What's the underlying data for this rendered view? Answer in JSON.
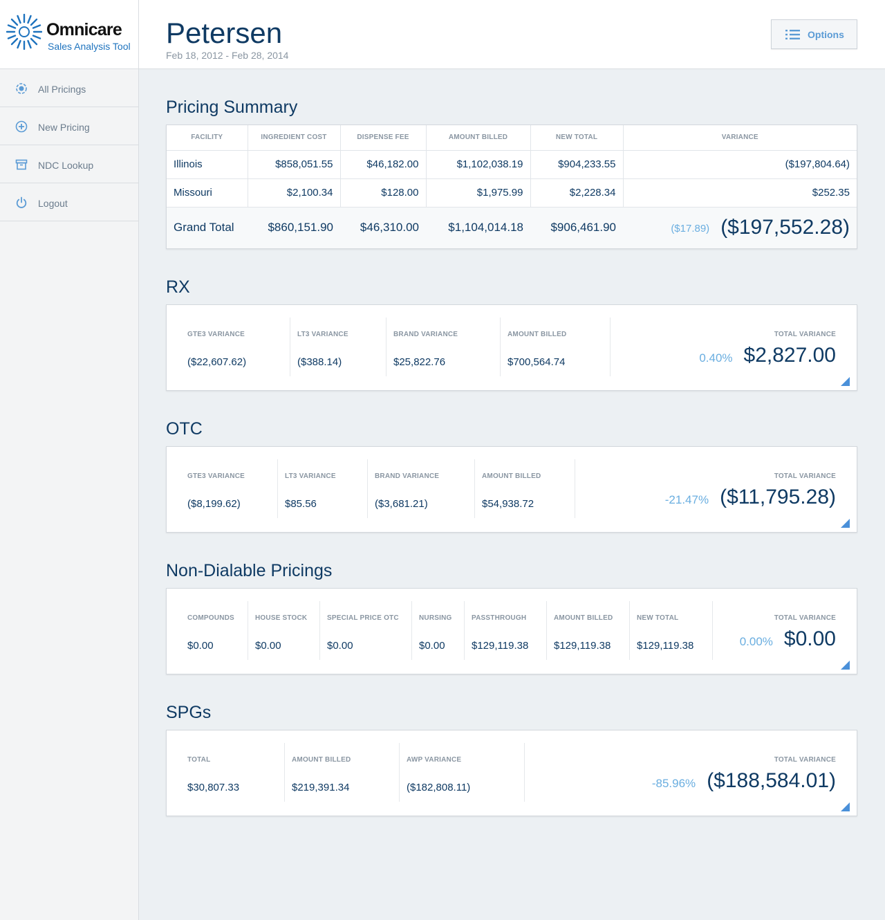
{
  "brand": {
    "name": "Omnicare",
    "subtitle": "Sales Analysis Tool"
  },
  "nav": [
    {
      "label": "All Pricings",
      "icon": "target-icon"
    },
    {
      "label": "New Pricing",
      "icon": "plus-circle-icon"
    },
    {
      "label": "NDC Lookup",
      "icon": "archive-icon"
    },
    {
      "label": "Logout",
      "icon": "power-icon"
    }
  ],
  "header": {
    "title": "Petersen",
    "date_range": "Feb 18, 2012 - Feb 28, 2014",
    "options_label": "Options"
  },
  "summary": {
    "title": "Pricing Summary",
    "columns": [
      "FACILITY",
      "INGREDIENT COST",
      "DISPENSE FEE",
      "AMOUNT BILLED",
      "NEW TOTAL",
      "VARIANCE"
    ],
    "rows": [
      [
        "Illinois",
        "$858,051.55",
        "$46,182.00",
        "$1,102,038.19",
        "$904,233.55",
        "($197,804.64)"
      ],
      [
        "Missouri",
        "$2,100.34",
        "$128.00",
        "$1,975.99",
        "$2,228.34",
        "$252.35"
      ]
    ],
    "total": {
      "label": "Grand Total",
      "ingredient_cost": "$860,151.90",
      "dispense_fee": "$46,310.00",
      "amount_billed": "$1,104,014.18",
      "new_total": "$906,461.90",
      "variance_pct": "($17.89)",
      "variance": "($197,552.28)"
    }
  },
  "rx": {
    "title": "RX",
    "metrics": [
      {
        "label": "GTE3 VARIANCE",
        "value": "($22,607.62)"
      },
      {
        "label": "LT3 VARIANCE",
        "value": "($388.14)"
      },
      {
        "label": "BRAND VARIANCE",
        "value": "$25,822.76"
      },
      {
        "label": "AMOUNT BILLED",
        "value": "$700,564.74"
      }
    ],
    "total_label": "TOTAL VARIANCE",
    "total_pct": "0.40%",
    "total_value": "$2,827.00"
  },
  "otc": {
    "title": "OTC",
    "metrics": [
      {
        "label": "GTE3 VARIANCE",
        "value": "($8,199.62)"
      },
      {
        "label": "LT3 VARIANCE",
        "value": "$85.56"
      },
      {
        "label": "BRAND VARIANCE",
        "value": "($3,681.21)"
      },
      {
        "label": "AMOUNT BILLED",
        "value": "$54,938.72"
      }
    ],
    "total_label": "TOTAL VARIANCE",
    "total_pct": "-21.47%",
    "total_value": "($11,795.28)"
  },
  "non_dialable": {
    "title": "Non-Dialable Pricings",
    "metrics": [
      {
        "label": "COMPOUNDS",
        "value": "$0.00"
      },
      {
        "label": "HOUSE STOCK",
        "value": "$0.00"
      },
      {
        "label": "SPECIAL PRICE OTC",
        "value": "$0.00"
      },
      {
        "label": "NURSING",
        "value": "$0.00"
      },
      {
        "label": "PASSTHROUGH",
        "value": "$129,119.38"
      },
      {
        "label": "AMOUNT BILLED",
        "value": "$129,119.38"
      },
      {
        "label": "NEW TOTAL",
        "value": "$129,119.38"
      }
    ],
    "total_label": "TOTAL VARIANCE",
    "total_pct": "0.00%",
    "total_value": "$0.00"
  },
  "spgs": {
    "title": "SPGs",
    "metrics": [
      {
        "label": "TOTAL",
        "value": "$30,807.33"
      },
      {
        "label": "AMOUNT BILLED",
        "value": "$219,391.34"
      },
      {
        "label": "AWP VARIANCE",
        "value": "($182,808.11)"
      }
    ],
    "total_label": "TOTAL VARIANCE",
    "total_pct": "-85.96%",
    "total_value": "($188,584.01)"
  },
  "colors": {
    "primary": "#0f3a63",
    "accent": "#5b9bd5",
    "muted": "#8a96a2",
    "background": "#ecf0f3"
  }
}
